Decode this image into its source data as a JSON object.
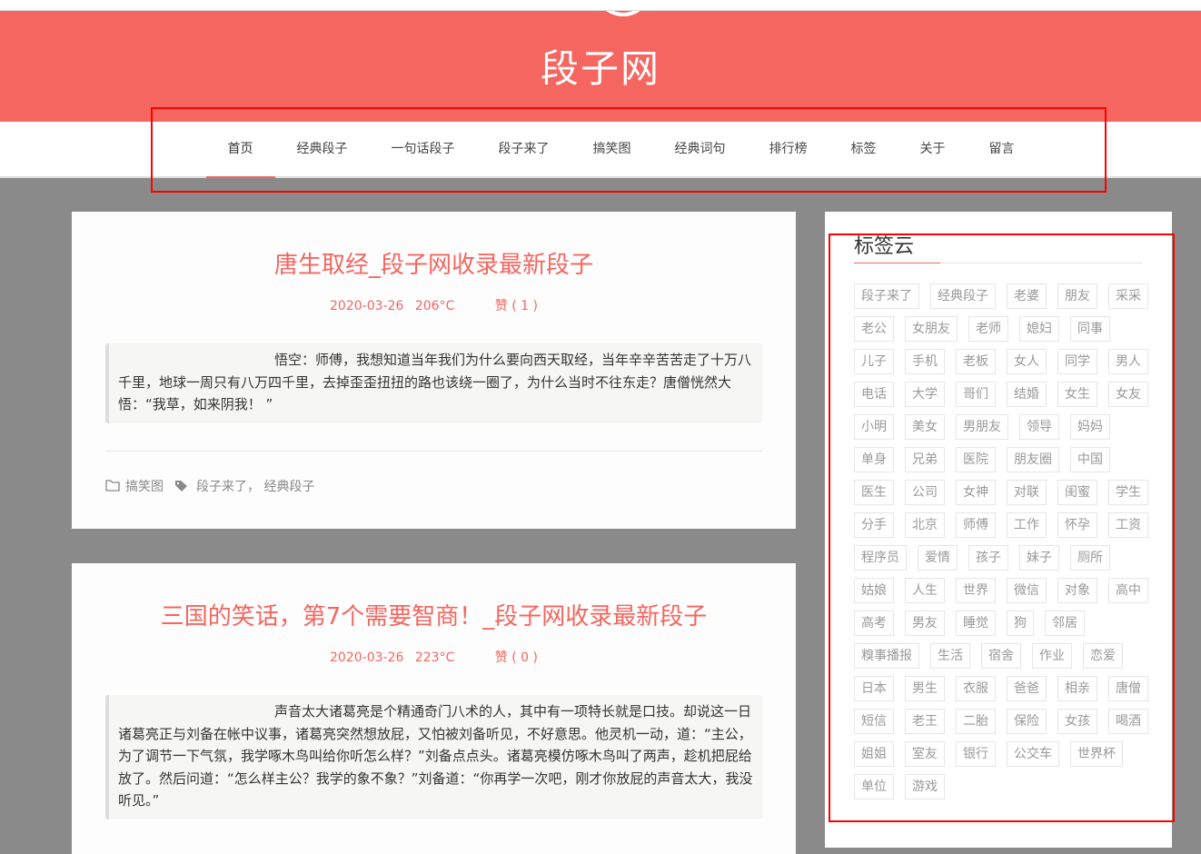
{
  "site": {
    "title": "段子网"
  },
  "nav": [
    {
      "label": "首页",
      "active": true
    },
    {
      "label": "经典段子"
    },
    {
      "label": "一句话段子"
    },
    {
      "label": "段子来了"
    },
    {
      "label": "搞笑图"
    },
    {
      "label": "经典词句"
    },
    {
      "label": "排行榜"
    },
    {
      "label": "标签"
    },
    {
      "label": "关于"
    },
    {
      "label": "留言"
    }
  ],
  "posts": [
    {
      "title": "唐生取经_段子网收录最新段子",
      "date": "2020-03-26",
      "views": "206°C",
      "likes": "赞 ( 1 )",
      "excerpt": "悟空：师傅，我想知道当年我们为什么要向西天取经，当年辛辛苦苦走了十万八千里，地球一周只有八万四千里，去掉歪歪扭扭的路也该绕一圈了，为什么当时不往东走？唐僧恍然大悟：“我草，如来阴我！ ”",
      "category": "搞笑图",
      "tags": "段子来了， 经典段子"
    },
    {
      "title": "三国的笑话，第7个需要智商！_段子网收录最新段子",
      "date": "2020-03-26",
      "views": "223°C",
      "likes": "赞 ( 0 )",
      "excerpt": "声音太大诸葛亮是个精通奇门八术的人，其中有一项特长就是口技。却说这一日诸葛亮正与刘备在帐中议事，诸葛亮突然想放屁，又怕被刘备听见，不好意思。他灵机一动，道：“主公，为了调节一下气氛，我学啄木鸟叫给你听怎么样？”刘备点点头。诸葛亮模仿啄木鸟叫了两声，趁机把屁给放了。然后问道：“怎么样主公？我学的象不象？”刘备道：“你再学一次吧，刚才你放屁的声音太大，我没听见。”"
    }
  ],
  "sidebar": {
    "title": "标签云",
    "tags": [
      "段子来了",
      "经典段子",
      "老婆",
      "朋友",
      "采采",
      "老公",
      "女朋友",
      "老师",
      "媳妇",
      "同事",
      "儿子",
      "手机",
      "老板",
      "女人",
      "同学",
      "男人",
      "电话",
      "大学",
      "哥们",
      "结婚",
      "女生",
      "女友",
      "小明",
      "美女",
      "男朋友",
      "领导",
      "妈妈",
      "单身",
      "兄弟",
      "医院",
      "朋友圈",
      "中国",
      "医生",
      "公司",
      "女神",
      "对联",
      "闺蜜",
      "学生",
      "分手",
      "北京",
      "师傅",
      "工作",
      "怀孕",
      "工资",
      "程序员",
      "爱情",
      "孩子",
      "妹子",
      "厕所",
      "姑娘",
      "人生",
      "世界",
      "微信",
      "对象",
      "高中",
      "高考",
      "男友",
      "睡觉",
      "狗",
      "邻居",
      "糗事播报",
      "生活",
      "宿舍",
      "作业",
      "恋爱",
      "日本",
      "男生",
      "衣服",
      "爸爸",
      "相亲",
      "唐僧",
      "短信",
      "老王",
      "二胎",
      "保险",
      "女孩",
      "喝酒",
      "姐姐",
      "室友",
      "银行",
      "公交车",
      "世界杯",
      "单位",
      "游戏"
    ]
  },
  "colors": {
    "brand": "#f4665f",
    "background": "#8a8a8a"
  }
}
